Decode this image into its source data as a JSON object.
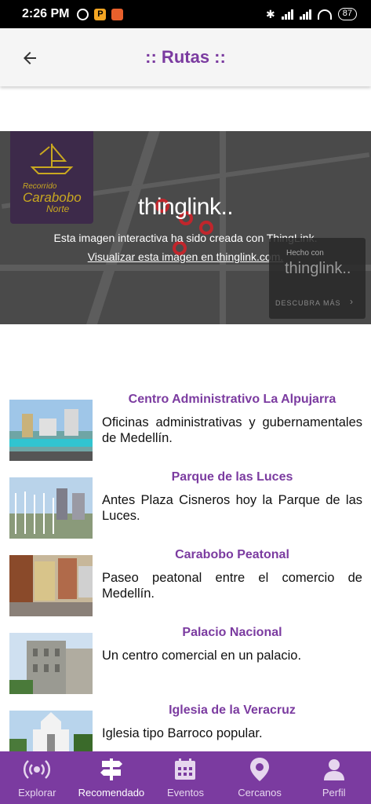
{
  "status": {
    "time": "2:26 PM",
    "battery": "87"
  },
  "header": {
    "title": ":: Rutas ::"
  },
  "map": {
    "logo_text_line1": "Recorrido",
    "logo_text_line2": "Carabobo",
    "logo_text_line3": "Norte",
    "brand": "thinglink..",
    "created_text": "Esta imagen interactiva ha sido creada con ThingLink.",
    "view_link": "Visualizar esta imagen en thinglink.com.",
    "badge_made": "Hecho con",
    "badge_brand": "thinglink..",
    "badge_more": "DESCUBRA MÁS"
  },
  "routes": [
    {
      "name": "Centro Administrativo La Alpujarra",
      "description": "Oficinas administrativas y gubernamentales de Medellín."
    },
    {
      "name": "Parque de las Luces",
      "description": "Antes Plaza Cisneros hoy la Parque de las Luces."
    },
    {
      "name": "Carabobo Peatonal",
      "description": "Paseo peatonal entre el comercio de Medellín."
    },
    {
      "name": "Palacio Nacional",
      "description": "Un centro comercial en un palacio."
    },
    {
      "name": "Iglesia de la Veracruz",
      "description": "Iglesia tipo Barroco popular."
    }
  ],
  "nav": {
    "items": [
      {
        "label": "Explorar",
        "icon": "broadcast-icon"
      },
      {
        "label": "Recomendado",
        "icon": "signpost-icon"
      },
      {
        "label": "Eventos",
        "icon": "calendar-icon"
      },
      {
        "label": "Cercanos",
        "icon": "location-pin-icon"
      },
      {
        "label": "Perfil",
        "icon": "user-icon"
      }
    ],
    "active": "Recomendado"
  },
  "colors": {
    "accent": "#7b3ba0",
    "pin": "#c0262c"
  }
}
